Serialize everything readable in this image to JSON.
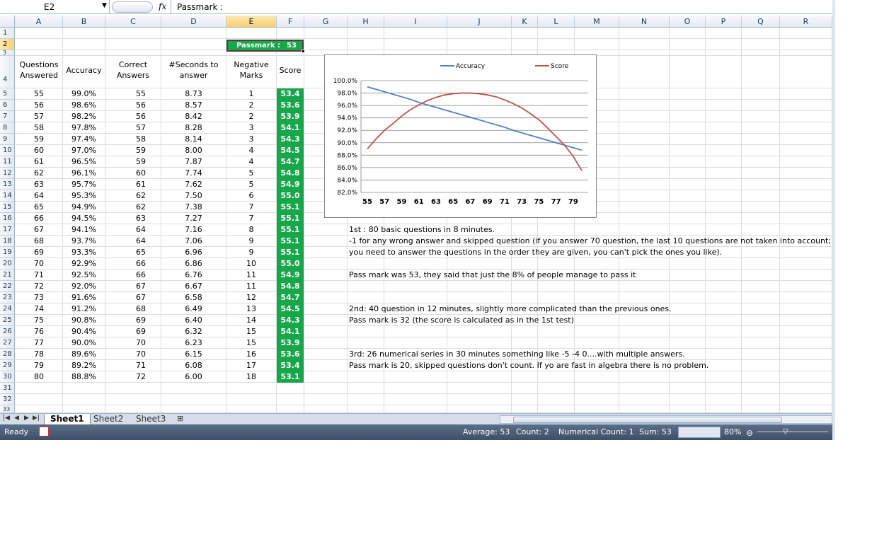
{
  "formula_bar": {
    "name_box": "E2",
    "content": "Passmark :"
  },
  "columns": [
    "A",
    "B",
    "C",
    "D",
    "E",
    "F",
    "G",
    "H",
    "I",
    "J",
    "K",
    "L",
    "M",
    "N",
    "O",
    "P",
    "Q",
    "R"
  ],
  "rows": [
    "1",
    "2",
    "3",
    "4",
    "5",
    "6",
    "7",
    "8",
    "9",
    "10",
    "11",
    "12",
    "13",
    "14",
    "15",
    "16",
    "17",
    "18",
    "19",
    "20",
    "21",
    "22",
    "23",
    "24",
    "25",
    "26",
    "27",
    "28",
    "29",
    "30",
    "31",
    "32",
    "33"
  ],
  "passmark": {
    "label": "Passmark :",
    "value": "53"
  },
  "headers": {
    "a": "Questions Answered",
    "b": "Accuracy",
    "c": "Correct Answers",
    "d": "#Seconds to answer",
    "e": "Negative Marks",
    "f": "Score"
  },
  "table": [
    [
      "55",
      "99.0%",
      "55",
      "8.73",
      "1",
      "53.4"
    ],
    [
      "56",
      "98.6%",
      "56",
      "8.57",
      "2",
      "53.6"
    ],
    [
      "57",
      "98.2%",
      "56",
      "8.42",
      "2",
      "53.9"
    ],
    [
      "58",
      "97.8%",
      "57",
      "8.28",
      "3",
      "54.1"
    ],
    [
      "59",
      "97.4%",
      "58",
      "8.14",
      "3",
      "54.3"
    ],
    [
      "60",
      "97.0%",
      "59",
      "8.00",
      "4",
      "54.5"
    ],
    [
      "61",
      "96.5%",
      "59",
      "7.87",
      "4",
      "54.7"
    ],
    [
      "62",
      "96.1%",
      "60",
      "7.74",
      "5",
      "54.8"
    ],
    [
      "63",
      "95.7%",
      "61",
      "7.62",
      "5",
      "54.9"
    ],
    [
      "64",
      "95.3%",
      "62",
      "7.50",
      "6",
      "55.0"
    ],
    [
      "65",
      "94.9%",
      "62",
      "7.38",
      "7",
      "55.1"
    ],
    [
      "66",
      "94.5%",
      "63",
      "7.27",
      "7",
      "55.1"
    ],
    [
      "67",
      "94.1%",
      "64",
      "7.16",
      "8",
      "55.1"
    ],
    [
      "68",
      "93.7%",
      "64",
      "7.06",
      "9",
      "55.1"
    ],
    [
      "69",
      "93.3%",
      "65",
      "6.96",
      "9",
      "55.1"
    ],
    [
      "70",
      "92.9%",
      "66",
      "6.86",
      "10",
      "55.0"
    ],
    [
      "71",
      "92.5%",
      "66",
      "6.76",
      "11",
      "54.9"
    ],
    [
      "72",
      "92.0%",
      "67",
      "6.67",
      "11",
      "54.8"
    ],
    [
      "73",
      "91.6%",
      "67",
      "6.58",
      "12",
      "54.7"
    ],
    [
      "74",
      "91.2%",
      "68",
      "6.49",
      "13",
      "54.5"
    ],
    [
      "75",
      "90.8%",
      "69",
      "6.40",
      "14",
      "54.3"
    ],
    [
      "76",
      "90.4%",
      "69",
      "6.32",
      "15",
      "54.1"
    ],
    [
      "77",
      "90.0%",
      "70",
      "6.23",
      "15",
      "53.9"
    ],
    [
      "78",
      "89.6%",
      "70",
      "6.15",
      "16",
      "53.6"
    ],
    [
      "79",
      "89.2%",
      "71",
      "6.08",
      "17",
      "53.4"
    ],
    [
      "80",
      "88.8%",
      "72",
      "6.00",
      "18",
      "53.1"
    ]
  ],
  "notes": {
    "n17": "1st : 80 basic questions in 8 minutes.",
    "n18": "-1 for any wrong answer and skipped question (if you answer 70 question, the last 10 questions are not taken into account;",
    "n19": "you need to answer the questions in the order they are given, you can't pick the ones you like).",
    "n21": "Pass mark was 53, they said that just the 8% of people manage to pass it",
    "n24": "2nd: 40 question in 12 minutes, slightly more complicated than the previous ones.",
    "n25": "Pass mark is 32 (the score is calculated as in the 1st test)",
    "n28": "3rd: 26 numerical series in 30 minutes something like -5 -4 0....with multiple answers.",
    "n29": "Pass mark is 20, skipped questions don't count. If yo are fast in algebra there is no problem."
  },
  "chart_data": {
    "type": "line",
    "x": [
      55,
      56,
      57,
      58,
      59,
      60,
      61,
      62,
      63,
      64,
      65,
      66,
      67,
      68,
      69,
      70,
      71,
      72,
      73,
      74,
      75,
      76,
      77,
      78,
      79,
      80
    ],
    "x_tick_labels": [
      "55",
      "57",
      "59",
      "61",
      "63",
      "65",
      "67",
      "69",
      "71",
      "73",
      "75",
      "77",
      "79"
    ],
    "y_tick_labels": [
      "82.0%",
      "84.0%",
      "86.0%",
      "88.0%",
      "90.0%",
      "92.0%",
      "94.0%",
      "96.0%",
      "98.0%",
      "100.0%"
    ],
    "ylim": [
      0.82,
      1.0
    ],
    "legend_position": "top",
    "series": [
      {
        "name": "Accuracy",
        "color": "#4f81bd",
        "values": [
          0.99,
          0.986,
          0.982,
          0.978,
          0.974,
          0.97,
          0.965,
          0.961,
          0.957,
          0.953,
          0.949,
          0.945,
          0.941,
          0.937,
          0.933,
          0.929,
          0.925,
          0.92,
          0.916,
          0.912,
          0.908,
          0.904,
          0.9,
          0.896,
          0.892,
          0.888
        ]
      },
      {
        "name": "Score",
        "color": "#c0504d",
        "values": [
          0.89,
          0.906,
          0.92,
          0.931,
          0.943,
          0.953,
          0.961,
          0.968,
          0.973,
          0.977,
          0.979,
          0.98,
          0.98,
          0.979,
          0.977,
          0.974,
          0.969,
          0.963,
          0.956,
          0.947,
          0.937,
          0.924,
          0.91,
          0.896,
          0.878,
          0.855
        ]
      }
    ]
  },
  "sheet_tabs": [
    "Sheet1",
    "Sheet2",
    "Sheet3"
  ],
  "status": {
    "ready": "Ready",
    "average": "Average: 53",
    "count": "Count: 2",
    "numerical_count": "Numerical Count: 1",
    "sum": "Sum: 53",
    "zoom": "80%"
  },
  "colors": {
    "score_fill": "#18a64a",
    "header_selected": "#f9cf6f",
    "status_bar": "#4a5d78"
  }
}
